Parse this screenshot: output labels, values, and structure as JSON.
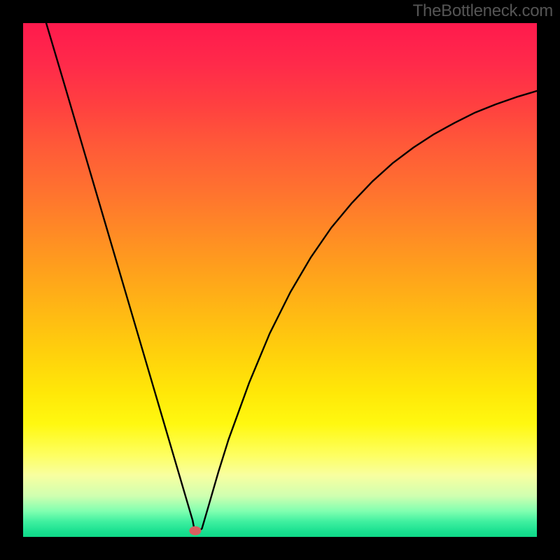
{
  "watermark": "TheBottleneck.com",
  "chart_data": {
    "type": "line",
    "title": "",
    "xlabel": "",
    "ylabel": "",
    "xlim": [
      0,
      100
    ],
    "ylim": [
      0,
      100
    ],
    "series": [
      {
        "name": "curve",
        "x": [
          4.5,
          8,
          12,
          16,
          20,
          24,
          28,
          30,
          32,
          33,
          33.3,
          33.3,
          34.2,
          34.8,
          36,
          38,
          40,
          44,
          48,
          52,
          56,
          60,
          64,
          68,
          72,
          76,
          80,
          84,
          88,
          92,
          96,
          100
        ],
        "values": [
          100,
          88.2,
          74.6,
          61.0,
          47.4,
          33.8,
          20.2,
          13.4,
          6.6,
          3.2,
          1.6,
          1.2,
          1.2,
          1.6,
          5.7,
          12.6,
          19.0,
          30.0,
          39.6,
          47.6,
          54.4,
          60.2,
          65.0,
          69.2,
          72.8,
          75.8,
          78.4,
          80.6,
          82.6,
          84.2,
          85.6,
          86.8
        ]
      }
    ],
    "marker": {
      "x": 33.5,
      "y": 1.2,
      "color": "#d86060"
    },
    "annotations": []
  }
}
